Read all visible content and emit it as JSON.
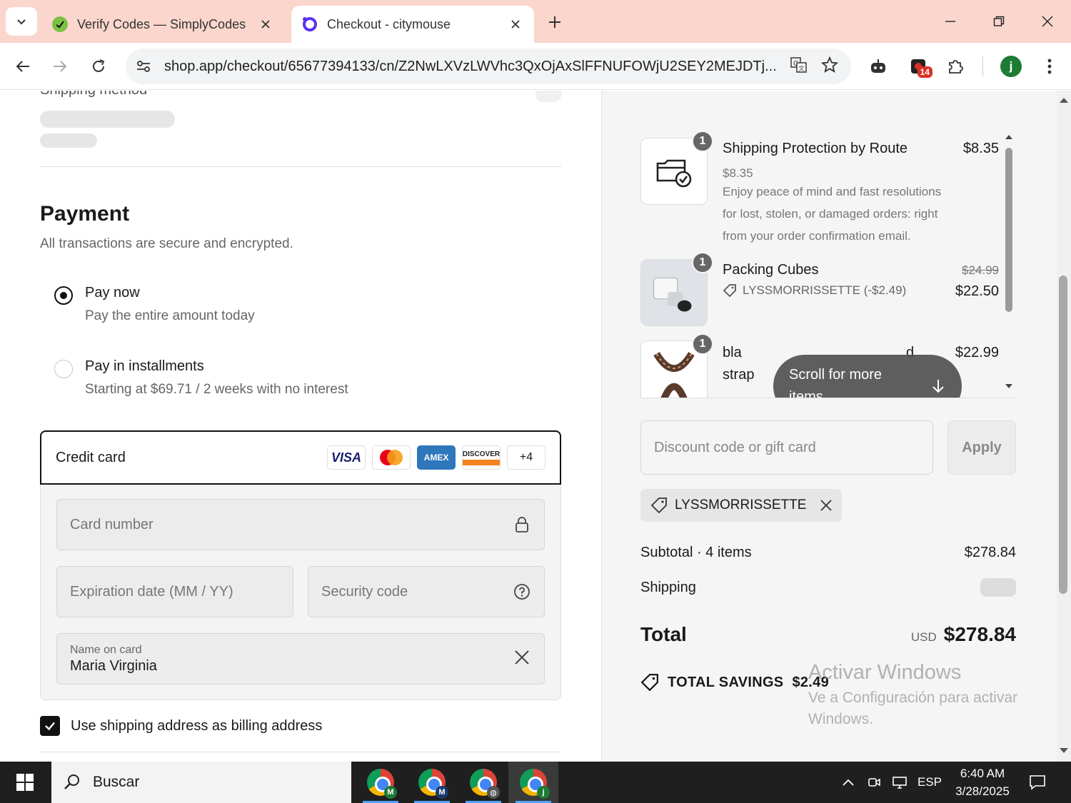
{
  "browser": {
    "tabs": [
      {
        "title": "Verify Codes — SimplyCodes",
        "active": false
      },
      {
        "title": "Checkout - citymouse",
        "active": true
      }
    ],
    "url": "shop.app/checkout/65677394133/cn/Z2NwLXVzLWVhc3QxOjAxSlFFNUFOWjU2SEY2MEJDTj...",
    "extension_badge": "14",
    "profile_initial": "j"
  },
  "checkout": {
    "shipping_method_heading": "Shipping method",
    "payment": {
      "title": "Payment",
      "subtitle": "All transactions are secure and encrypted.",
      "options": [
        {
          "label": "Pay now",
          "sub": "Pay the entire amount today",
          "selected": true
        },
        {
          "label": "Pay in installments",
          "sub": "Starting at $69.71 / 2 weeks with no interest",
          "selected": false
        }
      ],
      "credit_card_label": "Credit card",
      "brands": [
        "VISA",
        "Mastercard",
        "AMEX",
        "DISCOVER",
        "+4"
      ],
      "card_number_placeholder": "Card number",
      "expiration_placeholder": "Expiration date (MM / YY)",
      "security_placeholder": "Security code",
      "name_label": "Name on card",
      "name_value": "Maria Virginia",
      "billing_label": "Use shipping address as billing address",
      "billing_checked": true
    }
  },
  "summary": {
    "items": [
      {
        "qty": "1",
        "name": "Shipping Protection by Route",
        "price": "$8.35",
        "sub": "$8.35",
        "description": "Enjoy peace of mind and fast resolutions for lost, stolen, or damaged orders: right from your order confirmation email."
      },
      {
        "qty": "1",
        "name": "Packing Cubes",
        "original_price": "$24.99",
        "price": "$22.50",
        "discount": "LYSSMORRISSETTE (-$2.49)"
      },
      {
        "qty": "1",
        "name_start": "bla",
        "name_end": "d",
        "name_line2": "strap",
        "price": "$22.99"
      }
    ],
    "scroll_hint": "Scroll for more items",
    "discount_placeholder": "Discount code or gift card",
    "apply_label": "Apply",
    "applied_code": "LYSSMORRISSETTE",
    "subtotal_label": "Subtotal · 4 items",
    "subtotal_value": "$278.84",
    "shipping_label": "Shipping",
    "total_label": "Total",
    "total_currency": "USD",
    "total_value": "$278.84",
    "savings_label": "TOTAL SAVINGS",
    "savings_value": "$2.49"
  },
  "watermark": {
    "title": "Activar Windows",
    "subtitle": "Ve a Configuración para activar Windows."
  },
  "taskbar": {
    "search_placeholder": "Buscar",
    "language": "ESP",
    "time": "6:40 AM",
    "date": "3/28/2025"
  },
  "colors": {
    "tabstrip": "#fbd6cc",
    "summary_bg": "#f5f5f5",
    "accent_dark": "#111111",
    "taskbar": "#1f1f1f"
  }
}
